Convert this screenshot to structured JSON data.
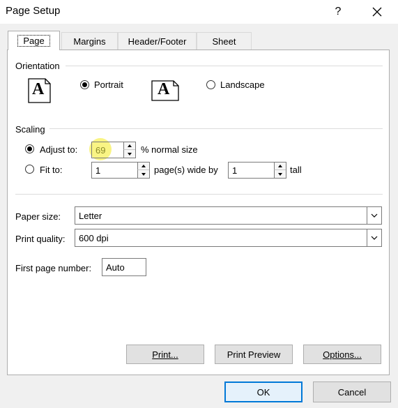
{
  "window": {
    "title": "Page Setup",
    "help_glyph": "?",
    "close_icon": "close-icon"
  },
  "tabs": [
    {
      "label": "Page",
      "active": true
    },
    {
      "label": "Margins",
      "active": false
    },
    {
      "label": "Header/Footer",
      "active": false
    },
    {
      "label": "Sheet",
      "active": false
    }
  ],
  "orientation": {
    "label": "Orientation",
    "portrait": {
      "label": "Portrait",
      "checked": true
    },
    "landscape": {
      "label": "Landscape",
      "checked": false
    },
    "icon_glyph": "A"
  },
  "scaling": {
    "label": "Scaling",
    "adjust_to": {
      "label": "Adjust to:",
      "value": "69",
      "suffix": "% normal size",
      "checked": true
    },
    "fit_to": {
      "label": "Fit to:",
      "wide_value": "1",
      "wide_suffix": "page(s) wide by",
      "tall_value": "1",
      "tall_suffix": "tall",
      "checked": false
    }
  },
  "paper_size": {
    "label": "Paper size:",
    "value": "Letter"
  },
  "print_quality": {
    "label": "Print quality:",
    "value": "600 dpi"
  },
  "first_page_number": {
    "label": "First page number:",
    "value": "Auto"
  },
  "buttons": {
    "print": "Print...",
    "print_preview": "Print Preview",
    "options": "Options...",
    "ok": "OK",
    "cancel": "Cancel"
  },
  "colors": {
    "accent": "#0078d7",
    "highlight": "#f8f26e",
    "panel": "#ffffff",
    "dialog": "#f0f0f0"
  }
}
